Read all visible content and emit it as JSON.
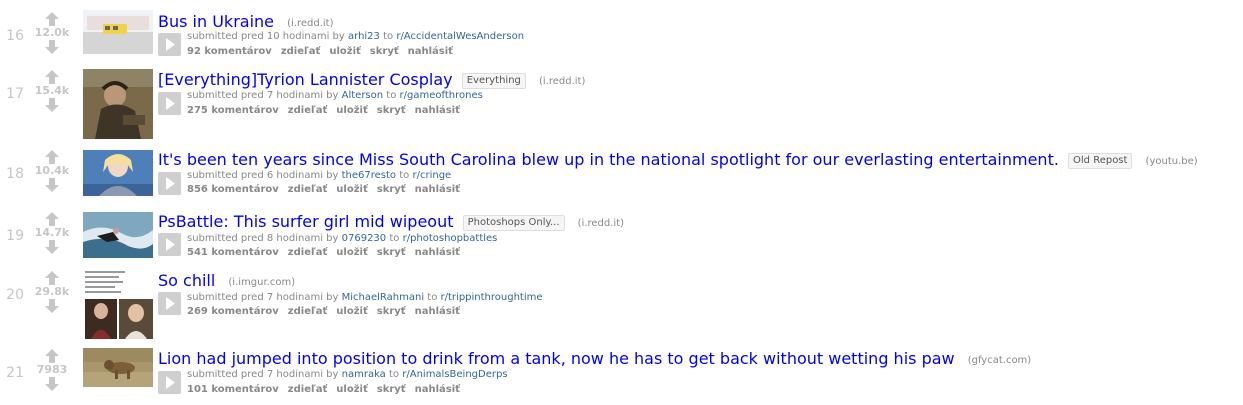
{
  "strings": {
    "submitted": "submitted pred",
    "by": "by",
    "to": "to",
    "comments_suffix": "komentárov",
    "share": "zdieľať",
    "save": "uložiť",
    "hide": "skryť",
    "report": "nahlásiť"
  },
  "posts": [
    {
      "rank": "16",
      "score": "12.0k",
      "title": "Bus in Ukraine",
      "flair": "",
      "domain": "(i.redd.it)",
      "time": "10 hodinami",
      "author": "arhi23",
      "subreddit": "r/AccidentalWesAnderson",
      "comments": "92 komentárov"
    },
    {
      "rank": "17",
      "score": "15.4k",
      "title": "[Everything]Tyrion Lannister Cosplay",
      "flair": "Everything",
      "domain": "(i.redd.it)",
      "time": "7 hodinami",
      "author": "Alterson",
      "subreddit": "r/gameofthrones",
      "comments": "275 komentárov"
    },
    {
      "rank": "18",
      "score": "10.4k",
      "title": "It's been ten years since Miss South Carolina blew up in the national spotlight for our everlasting entertainment.",
      "flair": "Old Repost",
      "domain": "(youtu.be)",
      "time": "6 hodinami",
      "author": "the67resto",
      "subreddit": "r/cringe",
      "comments": "856 komentárov"
    },
    {
      "rank": "19",
      "score": "14.7k",
      "title": "PsBattle: This surfer girl mid wipeout",
      "flair": "Photoshops Only...",
      "domain": "(i.redd.it)",
      "time": "8 hodinami",
      "author": "0769230",
      "subreddit": "r/photoshopbattles",
      "comments": "541 komentárov"
    },
    {
      "rank": "20",
      "score": "29.8k",
      "title": "So chill",
      "flair": "",
      "domain": "(i.imgur.com)",
      "time": "7 hodinami",
      "author": "MichaelRahmani",
      "subreddit": "r/trippinthroughtime",
      "comments": "269 komentárov"
    },
    {
      "rank": "21",
      "score": "7983",
      "title": "Lion had jumped into position to drink from a tank, now he has to get back without wetting his paw",
      "flair": "",
      "domain": "(gfycat.com)",
      "time": "7 hodinami",
      "author": "namraka",
      "subreddit": "r/AnimalsBeingDerps",
      "comments": "101 komentárov"
    }
  ]
}
